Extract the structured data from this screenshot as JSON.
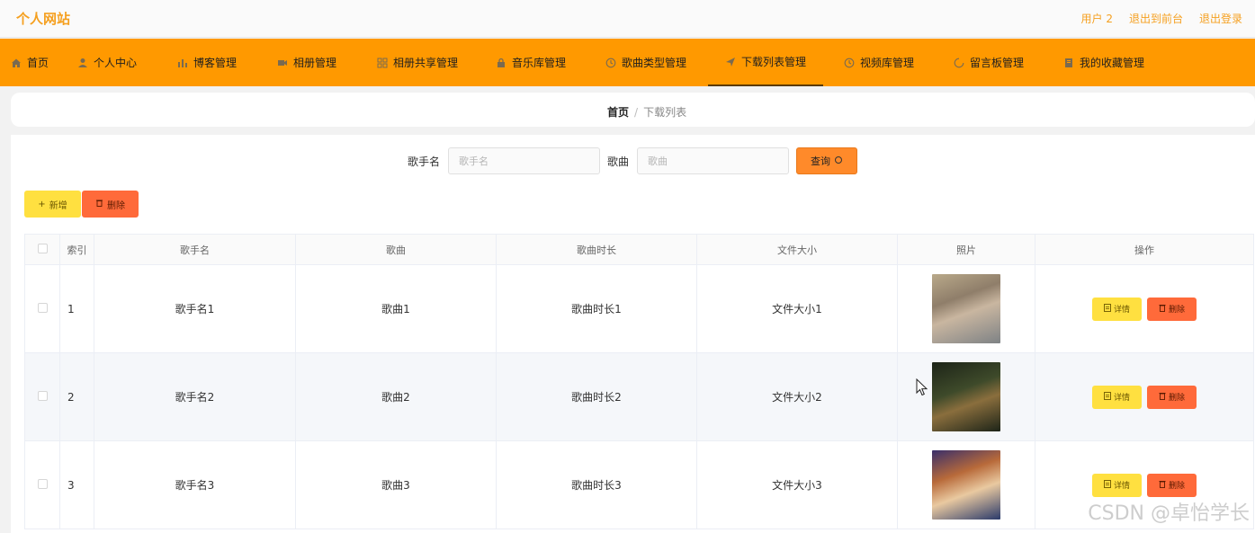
{
  "header": {
    "brand": "个人网站",
    "user": "用户 2",
    "back_to_front": "退出到前台",
    "logout": "退出登录"
  },
  "nav": {
    "items": [
      {
        "label": "首页",
        "icon": "home-icon"
      },
      {
        "label": "个人中心",
        "icon": "user-icon"
      },
      {
        "label": "博客管理",
        "icon": "bar-chart-icon"
      },
      {
        "label": "相册管理",
        "icon": "video-icon"
      },
      {
        "label": "相册共享管理",
        "icon": "grid-icon"
      },
      {
        "label": "音乐库管理",
        "icon": "lock-icon"
      },
      {
        "label": "歌曲类型管理",
        "icon": "clock-icon"
      },
      {
        "label": "下载列表管理",
        "icon": "send-icon"
      },
      {
        "label": "视频库管理",
        "icon": "clock-icon"
      },
      {
        "label": "留言板管理",
        "icon": "loading-icon"
      },
      {
        "label": "我的收藏管理",
        "icon": "document-icon"
      }
    ],
    "active": "下载列表管理"
  },
  "breadcrumb": {
    "home": "首页",
    "separator": "/",
    "current": "下载列表"
  },
  "search": {
    "singer_label": "歌手名",
    "singer_placeholder": "歌手名",
    "song_label": "歌曲",
    "song_placeholder": "歌曲",
    "query_label": "查询"
  },
  "actions": {
    "add_label": "新增",
    "delete_label": "删除"
  },
  "table": {
    "columns": [
      "索引",
      "歌手名",
      "歌曲",
      "歌曲时长",
      "文件大小",
      "照片",
      "操作"
    ],
    "rows": [
      {
        "index": "1",
        "singer": "歌手名1",
        "song": "歌曲1",
        "duration": "歌曲时长1",
        "size": "文件大小1"
      },
      {
        "index": "2",
        "singer": "歌手名2",
        "song": "歌曲2",
        "duration": "歌曲时长2",
        "size": "文件大小2"
      },
      {
        "index": "3",
        "singer": "歌手名3",
        "song": "歌曲3",
        "duration": "歌曲时长3",
        "size": "文件大小3"
      }
    ],
    "row_actions": {
      "detail_label": "详情",
      "remove_label": "删除"
    }
  },
  "watermark": "CSDN @卓怡学长",
  "colors": {
    "accent": "#ff9900",
    "brand_text": "#f5a020",
    "query_button": "#ff8a2a",
    "add_button": "#ffe040",
    "delete_button": "#ff6a3a"
  }
}
